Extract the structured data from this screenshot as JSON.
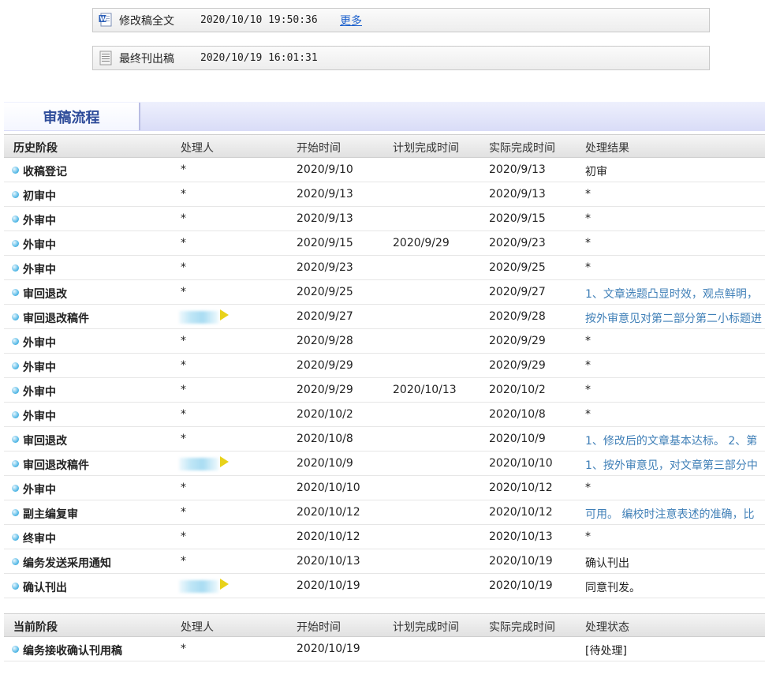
{
  "files": [
    {
      "icon": "word-doc-icon",
      "name": "修改稿全文",
      "time": "2020/10/10 19:50:36",
      "more": "更多"
    },
    {
      "icon": "document-lines-icon",
      "name": "最终刊出稿",
      "time": "2020/10/19 16:01:31"
    }
  ],
  "tab": {
    "title": "审稿流程"
  },
  "history": {
    "headers": [
      "历史阶段",
      "处理人",
      "开始时间",
      "计划完成时间",
      "实际完成时间",
      "处理结果"
    ],
    "rows": [
      {
        "stage": "收稿登记",
        "person": "*",
        "start": "2020/9/10",
        "plan": "",
        "done": "2020/9/13",
        "result": "初审"
      },
      {
        "stage": "初审中",
        "person": "*",
        "start": "2020/9/13",
        "plan": "",
        "done": "2020/9/13",
        "result": "*"
      },
      {
        "stage": "外审中",
        "person": "*",
        "start": "2020/9/13",
        "plan": "",
        "done": "2020/9/15",
        "result": "*"
      },
      {
        "stage": "外审中",
        "person": "*",
        "start": "2020/9/15",
        "plan": "2020/9/29",
        "done": "2020/9/23",
        "result": "*"
      },
      {
        "stage": "外审中",
        "person": "*",
        "start": "2020/9/23",
        "plan": "",
        "done": "2020/9/25",
        "result": "*"
      },
      {
        "stage": "审回退改",
        "person": "*",
        "start": "2020/9/25",
        "plan": "",
        "done": "2020/9/27",
        "result": "1、文章选题凸显时效，观点鲜明，"
      },
      {
        "stage": "审回退改稿件",
        "person": "",
        "start": "2020/9/27",
        "plan": "",
        "done": "2020/9/28",
        "result": "按外审意见对第二部分第二小标题进"
      },
      {
        "stage": "外审中",
        "person": "*",
        "start": "2020/9/28",
        "plan": "",
        "done": "2020/9/29",
        "result": "*"
      },
      {
        "stage": "外审中",
        "person": "*",
        "start": "2020/9/29",
        "plan": "",
        "done": "2020/9/29",
        "result": "*"
      },
      {
        "stage": "外审中",
        "person": "*",
        "start": "2020/9/29",
        "plan": "2020/10/13",
        "done": "2020/10/2",
        "result": "*"
      },
      {
        "stage": "外审中",
        "person": "*",
        "start": "2020/10/2",
        "plan": "",
        "done": "2020/10/8",
        "result": "*"
      },
      {
        "stage": "审回退改",
        "person": "*",
        "start": "2020/10/8",
        "plan": "",
        "done": "2020/10/9",
        "result": "1、修改后的文章基本达标。 2、第"
      },
      {
        "stage": "审回退改稿件",
        "person": "",
        "start": "2020/10/9",
        "plan": "",
        "done": "2020/10/10",
        "result": "1、按外审意见，对文章第三部分中"
      },
      {
        "stage": "外审中",
        "person": "*",
        "start": "2020/10/10",
        "plan": "",
        "done": "2020/10/12",
        "result": "*"
      },
      {
        "stage": "副主编复审",
        "person": "*",
        "start": "2020/10/12",
        "plan": "",
        "done": "2020/10/12",
        "result": "可用。 编校时注意表述的准确，比"
      },
      {
        "stage": "终审中",
        "person": "*",
        "start": "2020/10/12",
        "plan": "",
        "done": "2020/10/13",
        "result": "*"
      },
      {
        "stage": "编务发送采用通知",
        "person": "*",
        "start": "2020/10/13",
        "plan": "",
        "done": "2020/10/19",
        "result": "确认刊出"
      },
      {
        "stage": "确认刊出",
        "person": "",
        "start": "2020/10/19",
        "plan": "",
        "done": "2020/10/19",
        "result": "同意刊发。"
      }
    ]
  },
  "current": {
    "headers": [
      "当前阶段",
      "处理人",
      "开始时间",
      "计划完成时间",
      "实际完成时间",
      "处理状态"
    ],
    "rows": [
      {
        "stage": "编务接收确认刊用稿",
        "person": "*",
        "start": "2020/10/19",
        "plan": "",
        "done": "",
        "result": "[待处理]"
      }
    ]
  },
  "colors": {
    "link": "#3f7fb7",
    "tab_text": "#2e4c9a",
    "more_link": "#1a5fcc"
  }
}
